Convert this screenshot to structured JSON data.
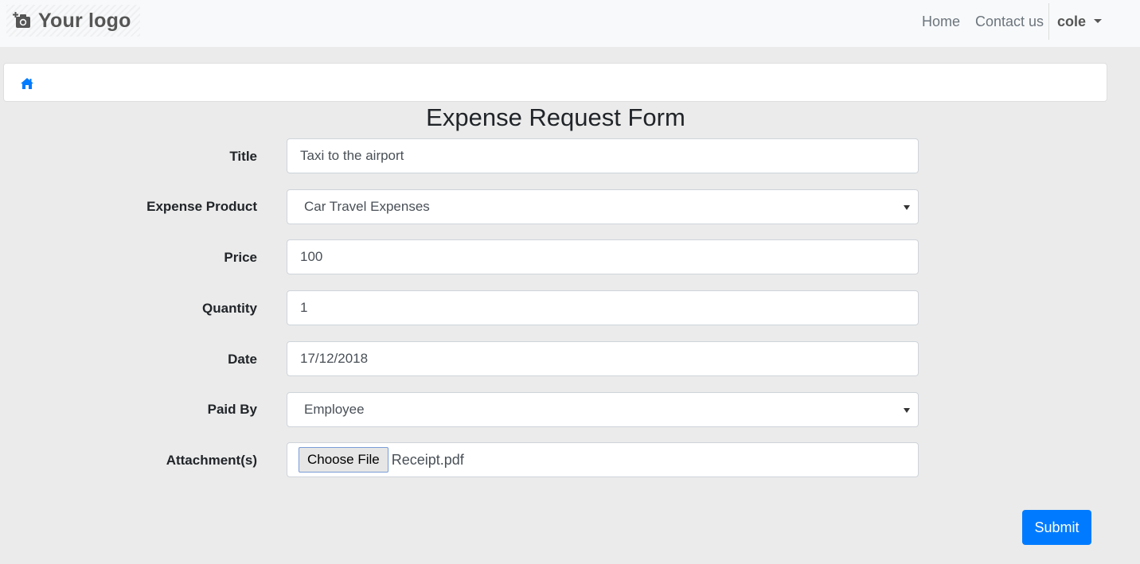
{
  "navbar": {
    "brand": "Your logo",
    "brand_icon": "camera-plus-icon",
    "links": [
      "Home",
      "Contact us"
    ],
    "user": "cole"
  },
  "breadcrumb": {
    "home_icon": "home-icon",
    "color": "#007bff"
  },
  "form": {
    "title": "Expense Request Form",
    "fields": {
      "title": {
        "label": "Title",
        "value": "Taxi to the airport"
      },
      "expense_product": {
        "label": "Expense Product",
        "value": "Car Travel Expenses"
      },
      "price": {
        "label": "Price",
        "value": "100"
      },
      "quantity": {
        "label": "Quantity",
        "value": "1"
      },
      "date": {
        "label": "Date",
        "value": "17/12/2018"
      },
      "paid_by": {
        "label": "Paid By",
        "value": "Employee"
      },
      "attachments": {
        "label": "Attachment(s)",
        "button": "Choose File",
        "file": "Receipt.pdf"
      }
    },
    "submit": "Submit"
  },
  "colors": {
    "primary": "#007bff",
    "background": "#ebebeb",
    "navbar": "#f8f9fa"
  }
}
